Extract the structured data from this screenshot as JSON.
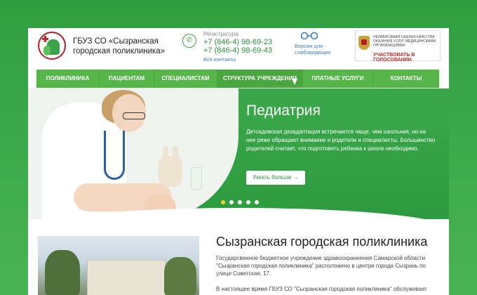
{
  "header": {
    "org_name": "ГБУЗ СО «Сызранская городская поликлиника»",
    "registry_label": "Регистратура",
    "phones": [
      "+7 (846-4) 98-69-23",
      "+7 (846-4) 98-69-43"
    ],
    "all_contacts": "Все контакты",
    "vision_link": "Версия для слабовидящих",
    "vote_small": "НЕЗАВИСИМАЯ ОЦЕНКА КАЧЕСТВА ОКАЗАНИЯ УСЛУГ МЕДИЦИНСКИМИ ОРГАНИЗАЦИЯМИ",
    "vote_red": "УЧАСТВОВАТЬ В ГОЛОСОВАНИИ"
  },
  "nav": {
    "items": [
      {
        "label": "ПОЛИКЛИНИКА"
      },
      {
        "label": "ПАЦИЕНТАМ"
      },
      {
        "label": "СПЕЦИАЛИСТАМ"
      },
      {
        "label": "СТРУКТУРА УЧРЕЖДЕНИЯ"
      },
      {
        "label": "ПЛАТНЫЕ УСЛУГИ"
      },
      {
        "label": "КОНТАКТЫ"
      }
    ],
    "active_index": 3
  },
  "hero": {
    "title": "Педиатрия",
    "text": "Детсадовская дезадаптация встречается чаще, чем школьная, но на нее реже обращают внимание и родители и специалисты.  Большинство родителей считает, что подготовить ребенка к школе необходимо.",
    "button": "Узнать больше →",
    "slides_total": 5,
    "active_slide": 1
  },
  "about": {
    "title": "Сызранская городская поликлиника",
    "text": "Государсвенное бюджетное учреждение здравоохраннения Самарской области \"Сызранская городская поликлиника\" расположено в центре города Сызрань по улице Советская, 17.",
    "text2": "В настоящее время ГБУЗ СО \"Сызранская городская поликлиника\" обслуживает"
  },
  "colors": {
    "brand_green": "#56b64a",
    "background_green": "#3aa84a",
    "link_blue": "#3c7dc4",
    "accent_red": "#c62828",
    "active_dot": "#f2d435"
  },
  "icons": [
    "logo-icon",
    "phone-icon",
    "glasses-icon",
    "emblem-icon"
  ]
}
